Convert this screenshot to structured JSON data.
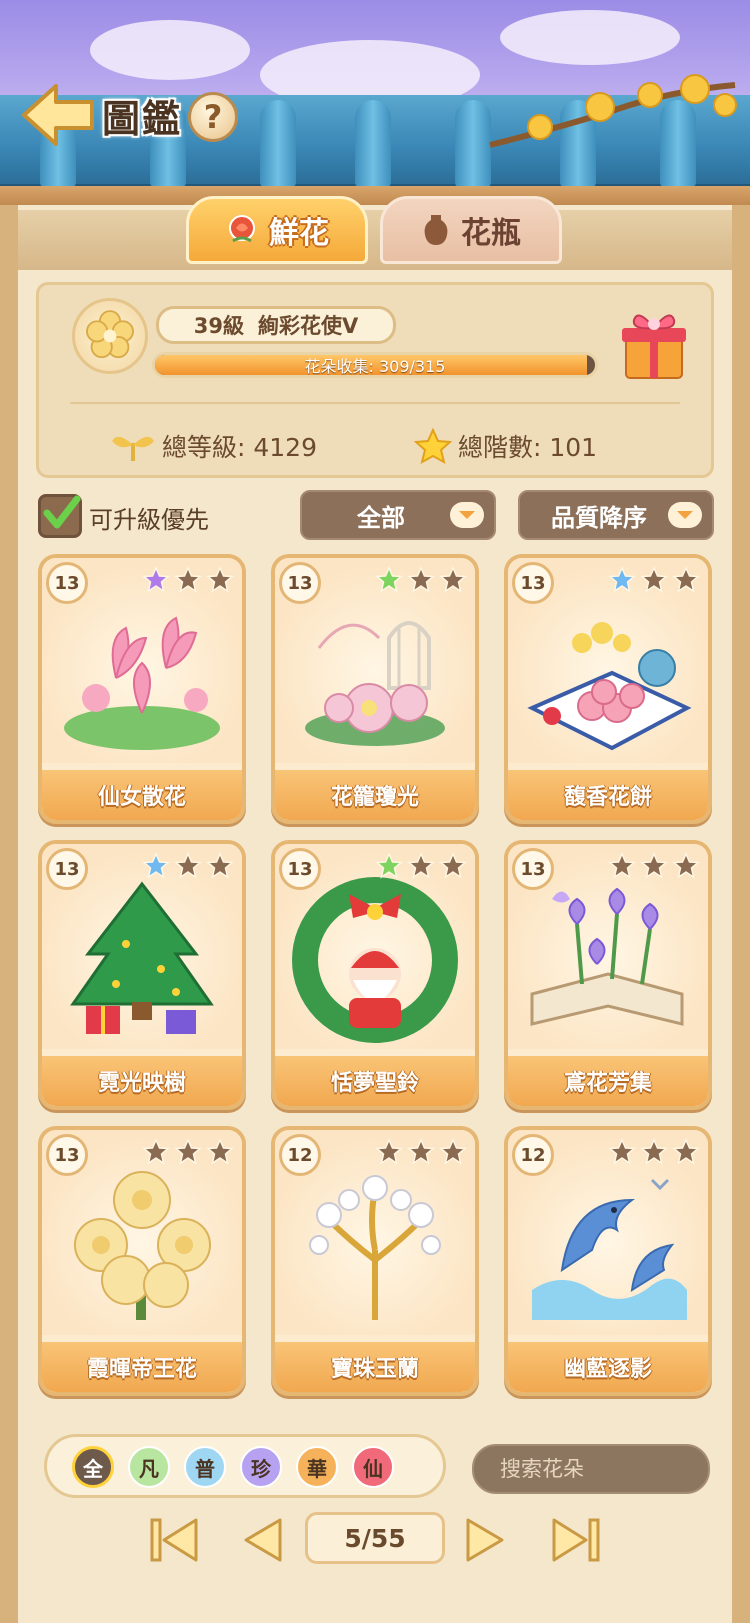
{
  "header": {
    "title": "圖鑑",
    "help_label": "?"
  },
  "tabs": [
    {
      "label": "鮮花",
      "active": true
    },
    {
      "label": "花瓶",
      "active": false
    }
  ],
  "stats": {
    "level": "39級",
    "rank_title": "絢彩花使V",
    "collection_label": "花朵收集: 309/315",
    "collection_progress": 0.981,
    "total_level": "總等級: 4129",
    "total_stage": "總階數: 101"
  },
  "filters": {
    "upgrade_first_label": "可升級優先",
    "upgrade_first_checked": true,
    "category": "全部",
    "sort": "品質降序"
  },
  "cards": [
    {
      "name": "仙女散花",
      "level": "13",
      "stars": [
        "purple",
        "gray",
        "gray"
      ],
      "icon": "lotus-flower-icon"
    },
    {
      "name": "花籠瓊光",
      "level": "13",
      "stars": [
        "green",
        "gray",
        "gray"
      ],
      "icon": "birdcage-flowers-icon"
    },
    {
      "name": "馥香花餅",
      "level": "13",
      "stars": [
        "blue",
        "gray",
        "gray"
      ],
      "icon": "flower-cake-tea-icon"
    },
    {
      "name": "霓光映樹",
      "level": "13",
      "stars": [
        "blue",
        "gray",
        "gray"
      ],
      "icon": "christmas-tree-icon"
    },
    {
      "name": "恬夢聖鈴",
      "level": "13",
      "stars": [
        "green",
        "gray",
        "gray"
      ],
      "icon": "santa-wreath-icon"
    },
    {
      "name": "鳶花芳集",
      "level": "13",
      "stars": [
        "gray",
        "gray",
        "gray"
      ],
      "icon": "iris-book-icon"
    },
    {
      "name": "霞暉帝王花",
      "level": "13",
      "stars": [
        "gray",
        "gray",
        "gray"
      ],
      "icon": "protea-flower-icon"
    },
    {
      "name": "寶珠玉蘭",
      "level": "12",
      "stars": [
        "gray",
        "gray",
        "gray"
      ],
      "icon": "magnolia-tree-icon"
    },
    {
      "name": "幽藍逐影",
      "level": "12",
      "stars": [
        "gray",
        "gray",
        "gray"
      ],
      "icon": "dolphin-icon"
    }
  ],
  "rarity_filters": [
    {
      "label": "全",
      "color": "#6e5a4a",
      "selected": true
    },
    {
      "label": "凡",
      "color": "#b8e6a0",
      "selected": false
    },
    {
      "label": "普",
      "color": "#9fd6f2",
      "selected": false
    },
    {
      "label": "珍",
      "color": "#b6a2f0",
      "selected": false
    },
    {
      "label": "華",
      "color": "#f6b25a",
      "selected": false
    },
    {
      "label": "仙",
      "color": "#f06a7a",
      "selected": false
    }
  ],
  "search": {
    "placeholder": "搜索花朵"
  },
  "pagination": {
    "page_label": "5/55"
  },
  "colors": {
    "star_purple": "#b07ae8",
    "star_green": "#7fd45f",
    "star_blue": "#6fb8f0",
    "star_gray": "#8a6b52",
    "accent_orange": "#f2a23f"
  }
}
